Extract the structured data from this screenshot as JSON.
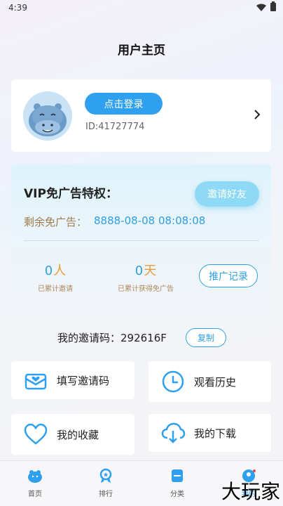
{
  "status_bar": {
    "time": "4:39"
  },
  "header": {
    "title": "用户主页"
  },
  "profile": {
    "login_label": "点击登录",
    "user_id": "ID:41727774"
  },
  "vip": {
    "title": "VIP免广告特权：",
    "invite_button": "邀请好友",
    "remaining_label": "剩余免广告：",
    "remaining_value": "8888-08-08 08:08:08",
    "stats": [
      {
        "value": "0",
        "unit": "人",
        "label": "已累计邀请"
      },
      {
        "value": "0",
        "unit": "天",
        "label": "已累计获得免广告"
      }
    ],
    "promo_record_button": "推广记录"
  },
  "invite_code": {
    "text": "我的邀请码：292616F",
    "copy_label": "复制"
  },
  "menu": [
    {
      "label": "填写邀请码",
      "icon": "mail-heart-icon"
    },
    {
      "label": "观看历史",
      "icon": "clock-icon"
    },
    {
      "label": "我的收藏",
      "icon": "heart-icon"
    },
    {
      "label": "我的下载",
      "icon": "cloud-download-icon"
    }
  ],
  "bottom_nav": [
    {
      "label": "首页",
      "icon": "hippo-icon"
    },
    {
      "label": "排行",
      "icon": "medal-icon"
    },
    {
      "label": "分类",
      "icon": "category-icon"
    },
    {
      "label": "我的",
      "icon": "user-icon"
    }
  ],
  "watermark": "大玩家",
  "colors": {
    "accent": "#2ea0ef",
    "gold": "#b0895c",
    "orange": "#e39d3e"
  }
}
